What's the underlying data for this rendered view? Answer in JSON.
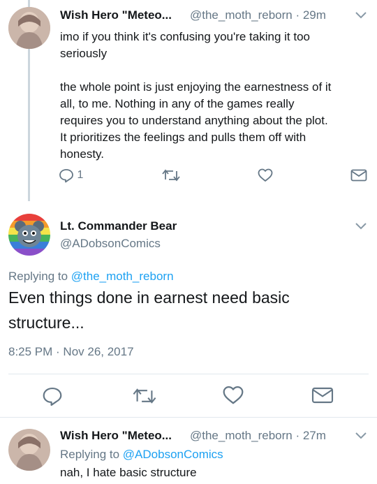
{
  "tweet1": {
    "name": "Wish Hero \"Meteo...",
    "handle": "@the_moth_reborn",
    "time": "· 29m",
    "text_p1_lines": [
      "imo if you think it's confusing you're taking it too",
      "seriously"
    ],
    "text_p2_lines": [
      "the whole point is just enjoying the earnestness of it",
      "all, to me. Nothing in any of the games really",
      "requires you to understand anything about the plot.",
      "It prioritizes the feelings and pulls them off with",
      "honesty."
    ],
    "reply_count": "1"
  },
  "tweet2": {
    "name": "Lt. Commander Bear",
    "handle": "@ADobsonComics",
    "replying_prefix": "Replying to",
    "replying_handle": "@the_moth_reborn",
    "text_lines": [
      "Even things done in earnest need basic",
      "structure..."
    ],
    "timestamp": "8:25 PM · Nov 26, 2017"
  },
  "tweet3": {
    "name": "Wish Hero \"Meteo...",
    "handle": "@the_moth_reborn",
    "time": "· 27m",
    "replying_prefix": "Replying to",
    "replying_handle": "@ADobsonComics",
    "text": "nah, I hate basic structure"
  },
  "colors": {
    "accent": "#1da1f2",
    "icon": "#657786",
    "text": "#14171a",
    "muted": "#657786"
  },
  "icons": [
    "reply-icon",
    "retweet-icon",
    "like-icon",
    "message-icon",
    "chevron-down-icon"
  ]
}
